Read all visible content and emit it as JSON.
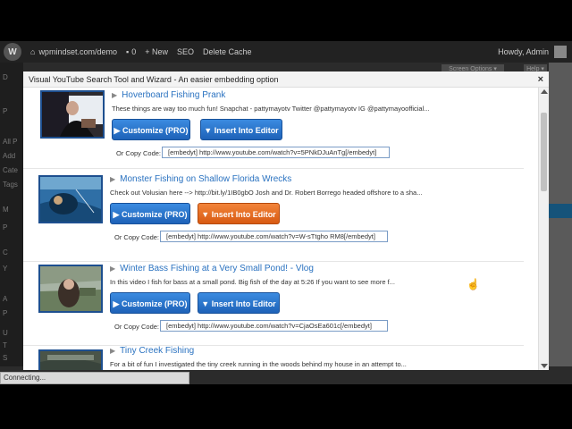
{
  "admin_bar": {
    "site": "wpmindset.com/demo",
    "comments_count": "0",
    "new_label": "+ New",
    "seo_label": "SEO",
    "cache_label": "Delete Cache",
    "user_label": "Howdy, Admin"
  },
  "sidebar": {
    "items": [
      "D",
      "P",
      "All P",
      "Add",
      "Cate",
      "Tags",
      "M",
      "P",
      "C",
      "Y",
      "A",
      "P",
      "U",
      "T",
      "S"
    ]
  },
  "screen_options_label": "Screen Options ▾",
  "help_label": "Help ▾",
  "status_text": "Connecting...",
  "modal": {
    "title": "Visual YouTube Search Tool and Wizard - An easier embedding option",
    "close_label": "×"
  },
  "results": [
    {
      "title": "Hoverboard Fishing Prank",
      "description": "These things are way too much fun! Snapchat - pattymayotv Twitter @pattymayotv IG @pattymayoofficial...",
      "customize_label": "▶ Customize (PRO)",
      "insert_label": "▼ Insert Into Editor",
      "copy_label": "Or Copy Code:",
      "embed_code": "[embedyt] http://www.youtube.com/watch?v=5PNkDJuAnTg[/embedyt]"
    },
    {
      "title": "Monster Fishing on Shallow Florida Wrecks",
      "description": "Check out Volusian here --> http://bit.ly/1IB0gbO Josh and Dr. Robert Borrego headed offshore to a sha...",
      "customize_label": "▶ Customize (PRO)",
      "insert_label": "▼ Insert Into Editor",
      "copy_label": "Or Copy Code:",
      "embed_code": "[embedyt] http://www.youtube.com/watch?v=W-sTtgho RM8[/embedyt]"
    },
    {
      "title": "Winter Bass Fishing at a Very Small Pond! - Vlog",
      "description": "In this video I fish for bass at a small pond. Big fish of the day at 5:26 If you want to see more f...",
      "customize_label": "▶ Customize (PRO)",
      "insert_label": "▼ Insert Into Editor",
      "copy_label": "Or Copy Code:",
      "embed_code": "[embedyt] http://www.youtube.com/watch?v=CjaOsEa601c[/embedyt]"
    },
    {
      "title": "Tiny Creek Fishing",
      "description": "For a bit of fun I investigated the tiny creek running in the woods behind my house in an attempt to..."
    }
  ],
  "colors": {
    "link_blue": "#2a72c0",
    "button_blue": "#1e62b8",
    "button_orange_hover": "#d85a12",
    "admin_bar": "#222222"
  }
}
